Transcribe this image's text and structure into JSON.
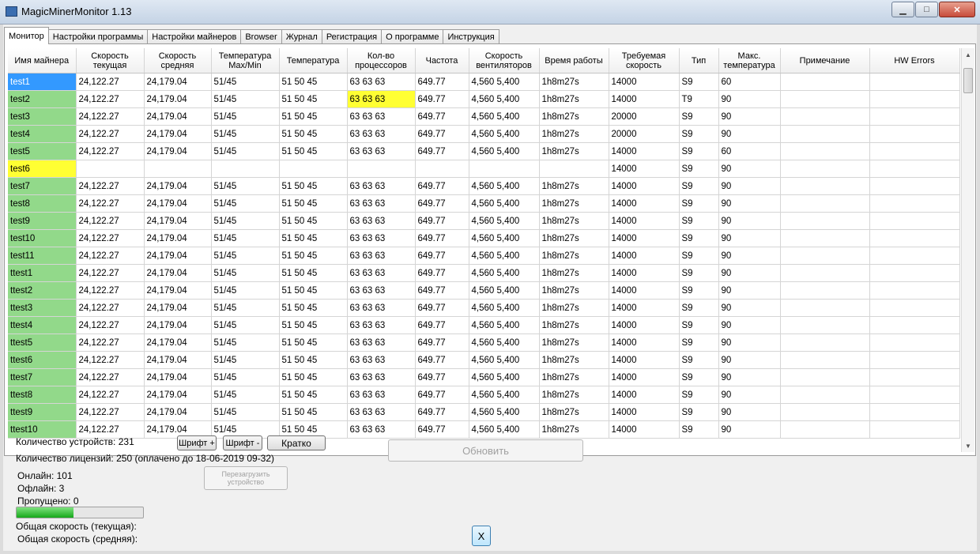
{
  "window": {
    "title": "MagicMinerMonitor 1.13",
    "min_label": "▁",
    "max_label": "□",
    "close_label": "✕"
  },
  "tabs": [
    {
      "label": "Монитор",
      "active": true
    },
    {
      "label": "Настройки программы"
    },
    {
      "label": "Настройки майнеров"
    },
    {
      "label": "Browser"
    },
    {
      "label": "Журнал"
    },
    {
      "label": "Регистрация"
    },
    {
      "label": "О программе"
    },
    {
      "label": "Инструкция"
    }
  ],
  "columns": [
    [
      "Имя майнера"
    ],
    [
      "Скорость",
      "текущая"
    ],
    [
      "Скорость",
      "средняя"
    ],
    [
      "Температура",
      "Max/Min"
    ],
    [
      "Температура"
    ],
    [
      "Кол-во",
      "процессоров"
    ],
    [
      "Частота"
    ],
    [
      "Скорость",
      "вентиляторов"
    ],
    [
      "Время работы"
    ],
    [
      "Требуемая",
      "скорость"
    ],
    [
      "Тип"
    ],
    [
      "Макс.",
      "температура"
    ],
    [
      "Примечание"
    ],
    [
      "HW Errors"
    ]
  ],
  "rows": [
    [
      "test1",
      "24,122.27",
      "24,179.04",
      "51/45",
      "51 50 45",
      "63 63 63",
      "649.77",
      "4,560 5,400",
      "1h8m27s",
      "14000",
      "S9",
      "60",
      "",
      ""
    ],
    [
      "test2",
      "24,122.27",
      "24,179.04",
      "51/45",
      "51 50 45",
      "63 63 63",
      "649.77",
      "4,560 5,400",
      "1h8m27s",
      "14000",
      "T9",
      "90",
      "",
      ""
    ],
    [
      "test3",
      "24,122.27",
      "24,179.04",
      "51/45",
      "51 50 45",
      "63 63 63",
      "649.77",
      "4,560 5,400",
      "1h8m27s",
      "20000",
      "S9",
      "90",
      "",
      ""
    ],
    [
      "test4",
      "24,122.27",
      "24,179.04",
      "51/45",
      "51 50 45",
      "63 63 63",
      "649.77",
      "4,560 5,400",
      "1h8m27s",
      "20000",
      "S9",
      "90",
      "",
      ""
    ],
    [
      "test5",
      "24,122.27",
      "24,179.04",
      "51/45",
      "51 50 45",
      "63 63 63",
      "649.77",
      "4,560 5,400",
      "1h8m27s",
      "14000",
      "S9",
      "60",
      "",
      ""
    ],
    [
      "test6",
      "",
      "",
      "",
      "",
      "",
      "",
      "",
      "",
      "14000",
      "S9",
      "90",
      "",
      ""
    ],
    [
      "test7",
      "24,122.27",
      "24,179.04",
      "51/45",
      "51 50 45",
      "63 63 63",
      "649.77",
      "4,560 5,400",
      "1h8m27s",
      "14000",
      "S9",
      "90",
      "",
      ""
    ],
    [
      "test8",
      "24,122.27",
      "24,179.04",
      "51/45",
      "51 50 45",
      "63 63 63",
      "649.77",
      "4,560 5,400",
      "1h8m27s",
      "14000",
      "S9",
      "90",
      "",
      ""
    ],
    [
      "test9",
      "24,122.27",
      "24,179.04",
      "51/45",
      "51 50 45",
      "63 63 63",
      "649.77",
      "4,560 5,400",
      "1h8m27s",
      "14000",
      "S9",
      "90",
      "",
      ""
    ],
    [
      "test10",
      "24,122.27",
      "24,179.04",
      "51/45",
      "51 50 45",
      "63 63 63",
      "649.77",
      "4,560 5,400",
      "1h8m27s",
      "14000",
      "S9",
      "90",
      "",
      ""
    ],
    [
      "test11",
      "24,122.27",
      "24,179.04",
      "51/45",
      "51 50 45",
      "63 63 63",
      "649.77",
      "4,560 5,400",
      "1h8m27s",
      "14000",
      "S9",
      "90",
      "",
      ""
    ],
    [
      "ttest1",
      "24,122.27",
      "24,179.04",
      "51/45",
      "51 50 45",
      "63 63 63",
      "649.77",
      "4,560 5,400",
      "1h8m27s",
      "14000",
      "S9",
      "90",
      "",
      ""
    ],
    [
      "ttest2",
      "24,122.27",
      "24,179.04",
      "51/45",
      "51 50 45",
      "63 63 63",
      "649.77",
      "4,560 5,400",
      "1h8m27s",
      "14000",
      "S9",
      "90",
      "",
      ""
    ],
    [
      "ttest3",
      "24,122.27",
      "24,179.04",
      "51/45",
      "51 50 45",
      "63 63 63",
      "649.77",
      "4,560 5,400",
      "1h8m27s",
      "14000",
      "S9",
      "90",
      "",
      ""
    ],
    [
      "ttest4",
      "24,122.27",
      "24,179.04",
      "51/45",
      "51 50 45",
      "63 63 63",
      "649.77",
      "4,560 5,400",
      "1h8m27s",
      "14000",
      "S9",
      "90",
      "",
      ""
    ],
    [
      "ttest5",
      "24,122.27",
      "24,179.04",
      "51/45",
      "51 50 45",
      "63 63 63",
      "649.77",
      "4,560 5,400",
      "1h8m27s",
      "14000",
      "S9",
      "90",
      "",
      ""
    ],
    [
      "ttest6",
      "24,122.27",
      "24,179.04",
      "51/45",
      "51 50 45",
      "63 63 63",
      "649.77",
      "4,560 5,400",
      "1h8m27s",
      "14000",
      "S9",
      "90",
      "",
      ""
    ],
    [
      "ttest7",
      "24,122.27",
      "24,179.04",
      "51/45",
      "51 50 45",
      "63 63 63",
      "649.77",
      "4,560 5,400",
      "1h8m27s",
      "14000",
      "S9",
      "90",
      "",
      ""
    ],
    [
      "ttest8",
      "24,122.27",
      "24,179.04",
      "51/45",
      "51 50 45",
      "63 63 63",
      "649.77",
      "4,560 5,400",
      "1h8m27s",
      "14000",
      "S9",
      "90",
      "",
      ""
    ],
    [
      "ttest9",
      "24,122.27",
      "24,179.04",
      "51/45",
      "51 50 45",
      "63 63 63",
      "649.77",
      "4,560 5,400",
      "1h8m27s",
      "14000",
      "S9",
      "90",
      "",
      ""
    ],
    [
      "ttest10",
      "24,122.27",
      "24,179.04",
      "51/45",
      "51 50 45",
      "63 63 63",
      "649.77",
      "4,560 5,400",
      "1h8m27s",
      "14000",
      "S9",
      "90",
      "",
      ""
    ]
  ],
  "highlights": [
    {
      "row": 0,
      "col": 0,
      "color": "#3399ff",
      "text_color": "#ffffff"
    },
    {
      "row": 1,
      "col": 5,
      "color": "#ffff33"
    },
    {
      "row": 5,
      "col": 0,
      "color": "#ffff33"
    }
  ],
  "colors": {
    "online_name": "#92d98a",
    "selected": "#3399ff",
    "warning": "#ffff33"
  },
  "scrollbar": {
    "up_icon": "▲",
    "down_icon": "▼"
  },
  "bottom": {
    "devices": "Количество устройств: 231",
    "licenses": "Количество лицензий: 250 (оплачено до 18-06-2019 09-32)",
    "online": "Онлайн: 101",
    "offline": "Офлайн: 3",
    "skipped": "Пропущено: 0",
    "total_current": "Общая скорость (текущая):",
    "total_avg": "Общая скорость (средняя):",
    "font_plus": "Шрифт +",
    "font_minus": "Шрифт -",
    "brief": "Кратко",
    "refresh": "Обновить",
    "reboot_line1": "Перезагрузить",
    "reboot_line2": "устройство",
    "close": "X",
    "progress": 0.45
  }
}
